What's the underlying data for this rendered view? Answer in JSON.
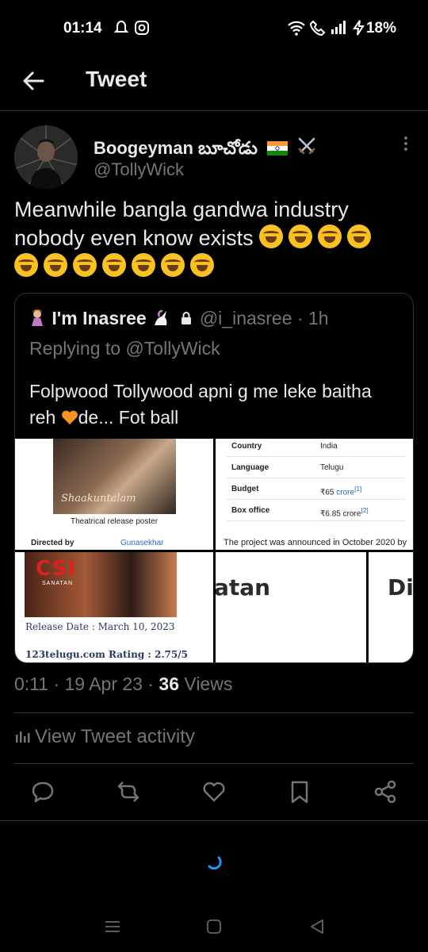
{
  "status_bar": {
    "time": "01:14",
    "battery": "18%",
    "icons": [
      "notification-icon",
      "instagram-icon",
      "wifi-icon",
      "call-icon",
      "signal-icon",
      "charging-icon"
    ]
  },
  "header": {
    "title": "Tweet",
    "back_icon": "arrow-left-icon"
  },
  "tweet": {
    "author_name": "Boogeyman బూచోడు",
    "author_handle": "@TollyWick",
    "text": "Meanwhile bangla gandwa industry nobody even know exists",
    "emoji_count_line1": 4,
    "emoji_count_line2": 7,
    "emoji": "rolling-on-floor-laughing",
    "timestamp": "0:11 · 19 Apr 23 · ",
    "views_count": "36",
    "views_label": " Views",
    "activity_label": "View Tweet activity"
  },
  "quote": {
    "name": "I'm Inasree",
    "handle": "@i_inasree · 1h",
    "replying_to": "Replying to @TollyWick",
    "text_part1": "Folpwood Tollywood apni g me leke baitha reh ",
    "text_part2": "de... Fot ball",
    "media": {
      "poster_title": "Shaakuntalam",
      "poster_caption": "Theatrical release poster",
      "directed_by_label": "Directed by",
      "directed_by_value": "Gunasekhar",
      "infobox": [
        {
          "key": "Country",
          "value": "India",
          "ref": ""
        },
        {
          "key": "Language",
          "value": "Telugu",
          "ref": ""
        },
        {
          "key": "Budget",
          "value": "₹65 ",
          "link": "crore",
          "ref": "[1]"
        },
        {
          "key": "Box office",
          "value": "₹6.85 crore",
          "link": "",
          "ref": "[2]"
        }
      ],
      "announcement": "The project was announced in October 2020 by",
      "csi_logo": "CSI",
      "csi_sub": "SANATAN",
      "release_date": "Release Date : March 10, 2023",
      "rating": "123telugu.com Rating : 2.75/5",
      "fragment1": "atan",
      "fragment2": "Di"
    }
  },
  "actions": [
    "reply-icon",
    "retweet-icon",
    "like-icon",
    "bookmark-icon",
    "share-icon"
  ],
  "colors": {
    "background": "#000000",
    "text_primary": "#e7e9ea",
    "text_secondary": "#71767b",
    "border": "#2f3336",
    "accent": "#1d9bf0"
  }
}
